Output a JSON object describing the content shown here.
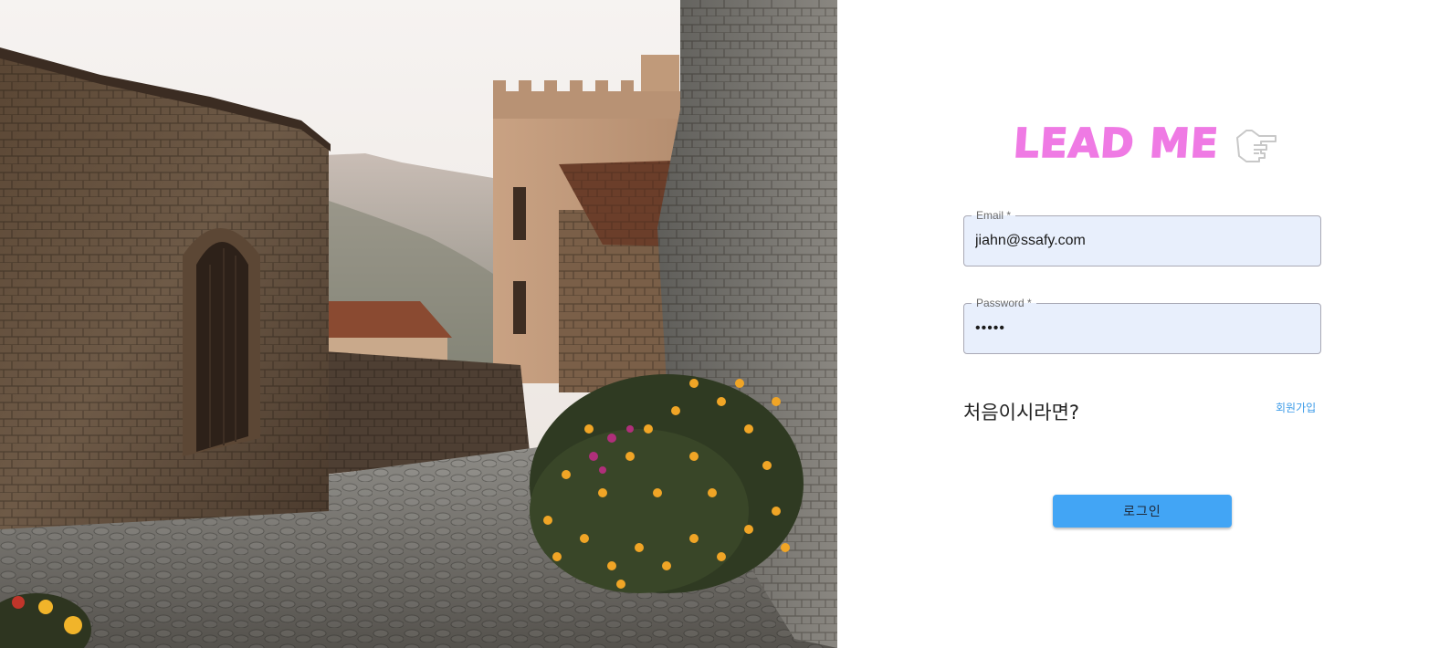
{
  "photo": {
    "alt_icon": "village-street-photo"
  },
  "logo": {
    "text": "LEAD ME",
    "icon": "pointing-hand-icon",
    "color": "#ef7ae4"
  },
  "form": {
    "email": {
      "label": "Email *",
      "value": "jiahn@ssafy.com"
    },
    "password": {
      "label": "Password *",
      "masked_value": "•••••"
    }
  },
  "signup": {
    "prompt": "처음이시라면?",
    "link_label": "회원가입"
  },
  "login_button": {
    "label": "로그인",
    "color": "#42a5f5"
  }
}
